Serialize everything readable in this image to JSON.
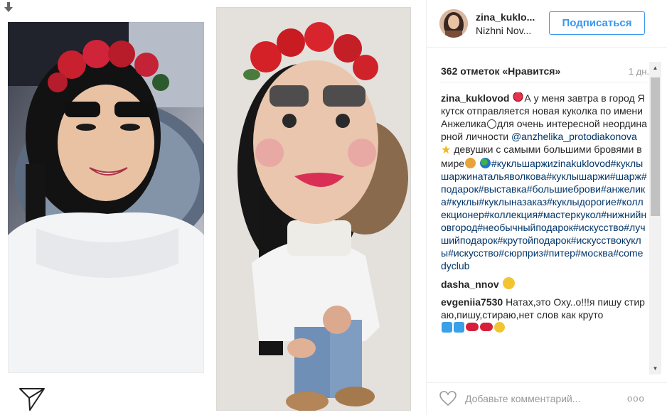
{
  "post": {
    "username": "zina_kuklovod",
    "username_display": "zina_kuklo...",
    "location": "Nizhni Nov...",
    "follow_label": "Подписаться",
    "likes": "362 отметок «Нравится»",
    "time_ago": "1 дн.",
    "caption": {
      "user": "zina_kuklovod",
      "text_1": "А у меня завтра в город Якутск отправляется новая куколка по имени Анжелика",
      "text_2": "для очень интересной неординарной личности",
      "mention": "@anzhelika_protodiakonova",
      "text_3": "девушки с самыми большими бровями в мире",
      "hashtags": "#кукльшаржиzinakuklovod#куклышаржинатальяволкова#куклышаржи#шарж#подарок#выставка#большиеброви#анжелика#куклы#куклыназаказ#куклыдорогие#коллекционер#коллекция#мастеркукол#нижнийновгород#необычныйподарок#искусство#лучшийподарок#крутойподарок#искусствокуклы#искусство#сюрприз#питер#москва#comedyclub"
    },
    "comments": [
      {
        "user": "dasha_nnov",
        "text": ""
      },
      {
        "user": "evgeniia7530",
        "text": "Натах,это Оху..о!!!я пишу стираю,пишу,стираю,нет слов как круто"
      }
    ],
    "add_comment_placeholder": "Добавьте комментарий...",
    "more_label": "ооо"
  },
  "icons": {
    "download": "download-arrow-icon",
    "share": "paper-plane-icon",
    "heart": "heart-icon",
    "more": "more-options-icon"
  },
  "colors": {
    "follow_blue": "#3897f0",
    "link": "#003569",
    "muted": "#999999"
  }
}
